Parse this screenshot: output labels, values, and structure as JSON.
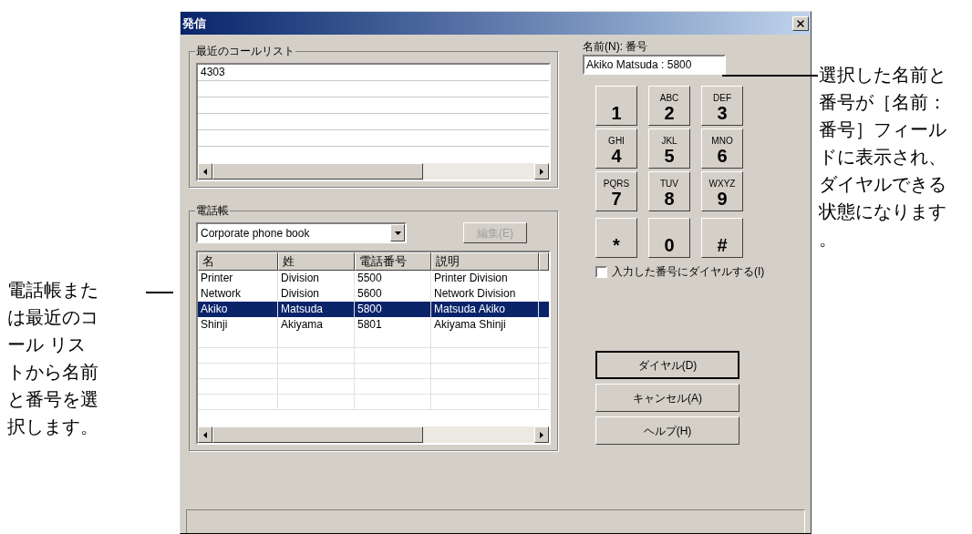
{
  "window": {
    "title": "発信"
  },
  "recent_calls": {
    "title": "最近のコールリスト",
    "items": [
      "4303"
    ]
  },
  "phone_book": {
    "title": "電話帳",
    "source": "Corporate phone book",
    "edit_button": {
      "label": "編集(E)",
      "disabled": true
    },
    "columns": [
      "名",
      "姓",
      "電話番号",
      "説明"
    ],
    "rows": [
      {
        "cells": [
          "Printer",
          "Division",
          "5500",
          "Printer Division"
        ],
        "selected": false
      },
      {
        "cells": [
          "Network",
          "Division",
          "5600",
          "Network Division"
        ],
        "selected": false
      },
      {
        "cells": [
          "Akiko",
          "Matsuda",
          "5800",
          "Matsuda Akiko"
        ],
        "selected": true
      },
      {
        "cells": [
          "Shinji",
          "Akiyama",
          "5801",
          "Akiyama Shinji"
        ],
        "selected": false
      }
    ]
  },
  "name_number": {
    "label": "名前(N): 番号",
    "value": "Akiko Matsuda : 5800"
  },
  "keypad": [
    {
      "keys": [
        {
          "digit": "1"
        },
        {
          "digit": "2",
          "letters": "ABC"
        },
        {
          "digit": "3",
          "letters": "DEF"
        }
      ]
    },
    {
      "keys": [
        {
          "digit": "4",
          "letters": "GHI"
        },
        {
          "digit": "5",
          "letters": "JKL"
        },
        {
          "digit": "6",
          "letters": "MNO"
        }
      ]
    },
    {
      "keys": [
        {
          "digit": "7",
          "letters": "PQRS"
        },
        {
          "digit": "8",
          "letters": "TUV"
        },
        {
          "digit": "9",
          "letters": "WXYZ"
        }
      ]
    },
    {
      "keys": [
        {
          "digit": "*"
        },
        {
          "digit": "0"
        },
        {
          "digit": "#"
        }
      ]
    }
  ],
  "dial_typed": {
    "label": "入力した番号にダイヤルする(I)",
    "checked": false
  },
  "buttons": [
    {
      "label": "ダイヤル(D)",
      "default": true
    },
    {
      "label": "キャンセル(A)",
      "default": false
    },
    {
      "label": "ヘルプ(H)",
      "default": false
    }
  ],
  "callouts": {
    "left": "電話帳または最近のコール リストから名前と番号を選択します。",
    "right": "選択した名前と番号が［名前：番号］フィールドに表示され、ダイヤルできる状態になります。"
  }
}
